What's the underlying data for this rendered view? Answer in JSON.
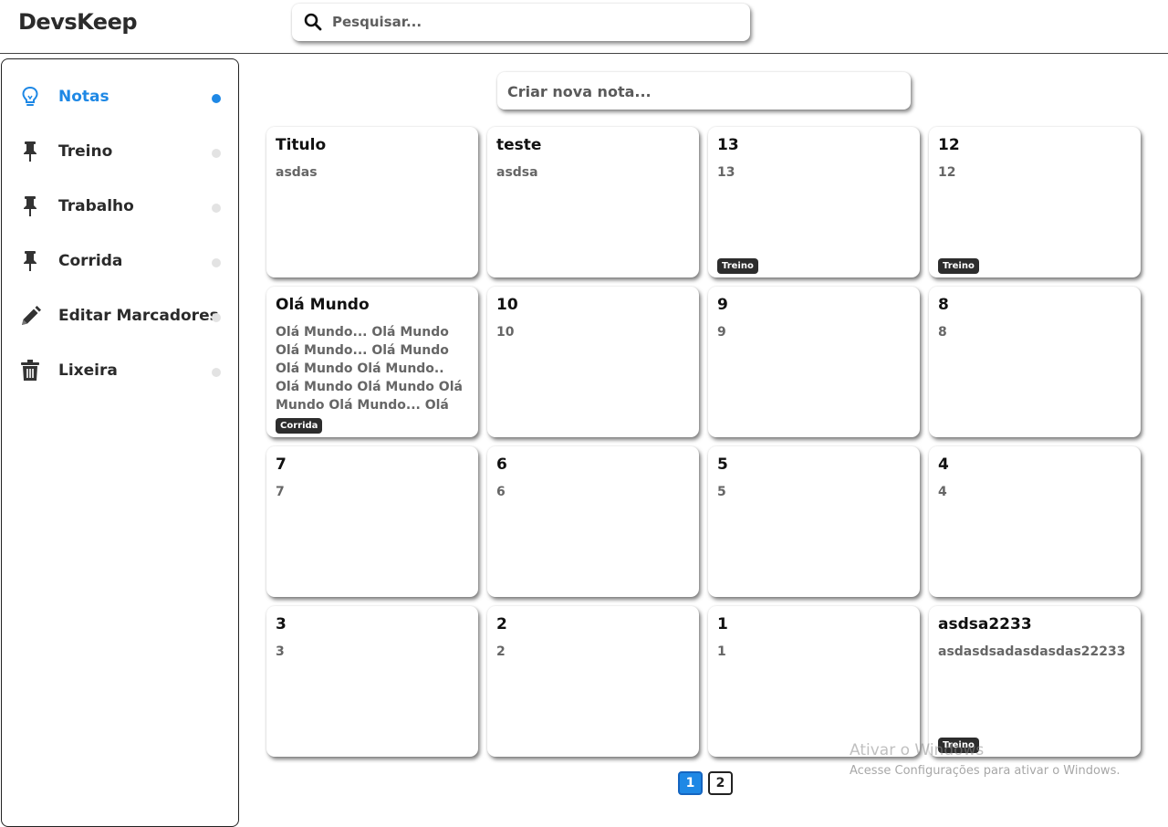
{
  "app": {
    "title": "DevsKeep"
  },
  "search": {
    "placeholder": "Pesquisar..."
  },
  "sidebar": {
    "items": [
      {
        "label": "Notas",
        "icon": "lightbulb-icon",
        "active": true
      },
      {
        "label": "Treino",
        "icon": "pin-icon",
        "active": false
      },
      {
        "label": "Trabalho",
        "icon": "pin-icon",
        "active": false
      },
      {
        "label": "Corrida",
        "icon": "pin-icon",
        "active": false
      },
      {
        "label": "Editar Marcadores",
        "icon": "pencil-icon",
        "active": false
      },
      {
        "label": "Lixeira",
        "icon": "trash-icon",
        "active": false
      }
    ]
  },
  "create_note": {
    "placeholder": "Criar nova nota..."
  },
  "notes": [
    {
      "title": "Titulo",
      "body": "asdas",
      "tag": ""
    },
    {
      "title": "teste",
      "body": "asdsa",
      "tag": ""
    },
    {
      "title": "13",
      "body": "13",
      "tag": "Treino"
    },
    {
      "title": "12",
      "body": "12",
      "tag": "Treino"
    },
    {
      "title": "Olá Mundo",
      "body": "Olá Mundo... Olá Mundo Olá Mundo... Olá Mundo Olá Mundo Olá Mundo.. Olá Mundo Olá Mundo Olá Mundo Olá Mundo... Olá",
      "tag": "Corrida"
    },
    {
      "title": "10",
      "body": "10",
      "tag": ""
    },
    {
      "title": "9",
      "body": "9",
      "tag": ""
    },
    {
      "title": "8",
      "body": "8",
      "tag": ""
    },
    {
      "title": "7",
      "body": "7",
      "tag": ""
    },
    {
      "title": "6",
      "body": "6",
      "tag": ""
    },
    {
      "title": "5",
      "body": "5",
      "tag": ""
    },
    {
      "title": "4",
      "body": "4",
      "tag": ""
    },
    {
      "title": "3",
      "body": "3",
      "tag": ""
    },
    {
      "title": "2",
      "body": "2",
      "tag": ""
    },
    {
      "title": "1",
      "body": "1",
      "tag": ""
    },
    {
      "title": "asdsa2233",
      "body": "asdasdsadasdasdas22233",
      "tag": "Treino"
    }
  ],
  "pagination": {
    "pages": [
      "1",
      "2"
    ],
    "current": "1"
  },
  "watermark": {
    "line1": "Ativar o Windows",
    "line2": "Acesse Configurações para ativar o Windows."
  },
  "colors": {
    "accent": "#1e88e5",
    "tag_bg": "#2d2d2d",
    "inactive_dot": "#e3e3e3"
  }
}
